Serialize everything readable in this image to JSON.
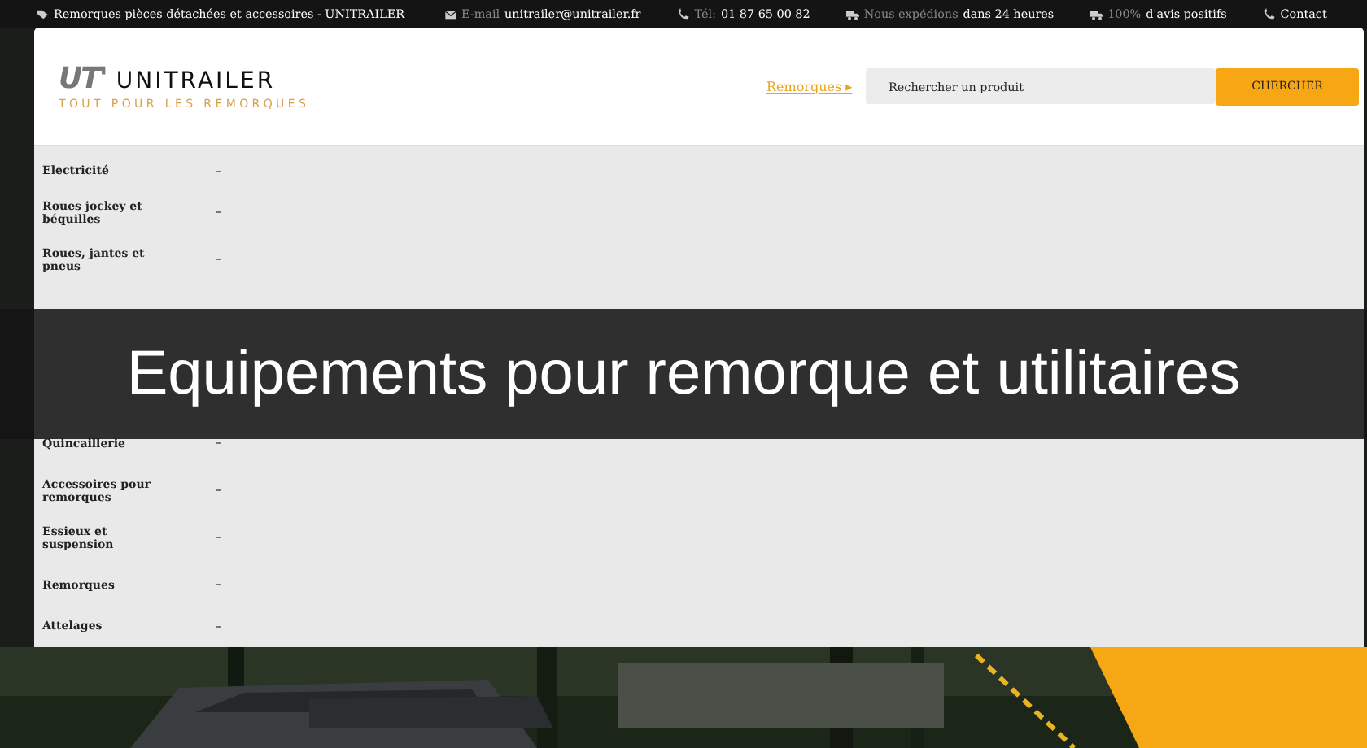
{
  "top_bar": [
    {
      "kind": "tag",
      "value": "Remorques pièces détachées et accessoires - UNITRAILER"
    },
    {
      "kind": "mail",
      "label": "E-mail",
      "value": "unitrailer@unitrailer.fr"
    },
    {
      "kind": "phone",
      "label": "Tél:",
      "value": "01 87 65 00 82"
    },
    {
      "kind": "truck",
      "label": "Nous expédions",
      "value": "dans 24 heures"
    },
    {
      "kind": "truck",
      "label": "100%",
      "value": "d'avis positifs"
    },
    {
      "kind": "phone",
      "value": "Contact"
    }
  ],
  "logo": {
    "mark": "UT'",
    "name": "UNITRAILER",
    "tagline": "TOUT POUR LES REMORQUES"
  },
  "breadcrumb_link": "Remorques ▸",
  "search": {
    "placeholder": "Rechercher un produit",
    "button": "CHERCHER"
  },
  "menu": [
    {
      "label": "Electricité"
    },
    {
      "label": "Roues jockey et béquilles"
    },
    {
      "label": "Roues, jantes et pneus"
    },
    {
      "label": "Quincaillerie"
    },
    {
      "label": "Accessoires pour remorques"
    },
    {
      "label": "Essieux et suspension"
    },
    {
      "label": "Remorques"
    },
    {
      "label": "Attelages"
    }
  ],
  "banner": "Equipements pour remorque et utilitaires"
}
